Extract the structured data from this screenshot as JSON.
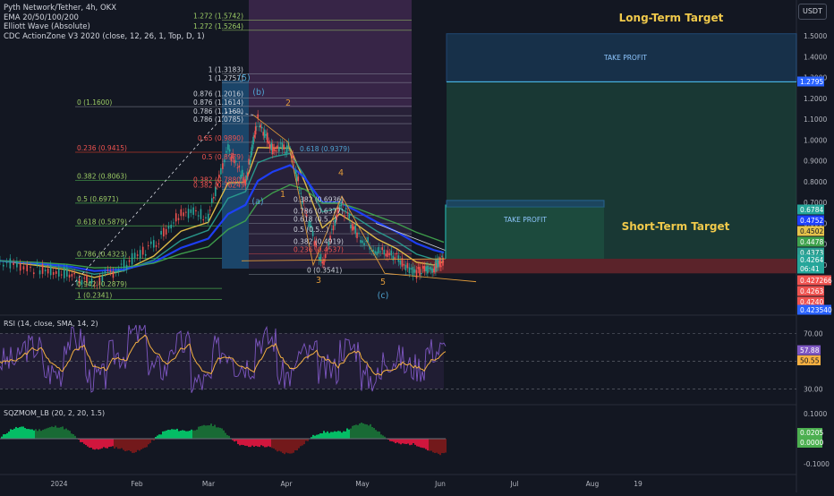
{
  "header": {
    "title": "Pyth Network/Tether, 4h, OKX",
    "indicators": [
      "EMA 20/50/100/200",
      "Elliott Wave (Absolute)",
      "CDC ActionZone V3 2020 (close, 12, 26, 1, Top, D, 1)"
    ],
    "currency_button": "USDT"
  },
  "colors": {
    "background": "#131722",
    "ema20": "#e6c34a",
    "ema50": "#2a9d8f",
    "ema100": "#1e40ff",
    "ema200": "#3fa34d",
    "candle_up": "#26a69a",
    "candle_down": "#ef5350",
    "wave": "#e09a3a",
    "rsi_line": "#7e57c2",
    "rsi_signal": "#f5b041",
    "tp_box": "#1e4f7a",
    "sl_box": "#7a2a2e",
    "target_text": "#f0c94b"
  },
  "chart_data": [
    {
      "type": "line",
      "title": "Pyth Network/Tether, 4h, OKX",
      "x": [
        "2023-12-05",
        "2023-12-20",
        "2024-01-01",
        "2024-01-12",
        "2024-01-24",
        "2024-02-05",
        "2024-02-16",
        "2024-02-27",
        "2024-03-06",
        "2024-03-13",
        "2024-03-18",
        "2024-03-24",
        "2024-03-31",
        "2024-04-06",
        "2024-04-13",
        "2024-04-20",
        "2024-04-27",
        "2024-05-05",
        "2024-05-13",
        "2024-05-21",
        "2024-05-28",
        "2024-06-01"
      ],
      "series": [
        {
          "name": "close",
          "values": [
            0.42,
            0.38,
            0.36,
            0.31,
            0.4,
            0.5,
            0.66,
            0.64,
            0.95,
            0.8,
            1.1,
            0.96,
            0.96,
            0.66,
            0.4,
            0.7,
            0.55,
            0.47,
            0.44,
            0.36,
            0.39,
            0.43
          ]
        }
      ],
      "xticks": [
        "2024",
        "Feb",
        "Mar",
        "Apr",
        "May",
        "Jun",
        "Jul",
        "Aug",
        "19"
      ],
      "yticks": [
        1.5,
        1.4,
        1.3,
        1.2,
        1.1,
        1.0,
        0.9,
        0.8,
        0.7,
        0.6,
        0.5,
        0.4
      ],
      "ylim": [
        0.22,
        1.62
      ],
      "price_labels": [
        "1.2795",
        "0.6784",
        "0.4752",
        "0.4502",
        "0.4478",
        "0.4373",
        "0.4264",
        "06:41",
        "0.427266",
        "0.4263",
        "0.4240",
        "0.423540"
      ],
      "fib_left": [
        {
          "text": "0 (1.1600)",
          "value": 1.16
        },
        {
          "text": "0.236 (0.9415)",
          "value": 0.9415
        },
        {
          "text": "0.382 (0.8063)",
          "value": 0.8063
        },
        {
          "text": "0.5 (0.6971)",
          "value": 0.6971
        },
        {
          "text": "0.618 (0.5879)",
          "value": 0.5879
        },
        {
          "text": "0.786 (0.4323)",
          "value": 0.4323
        },
        {
          "text": "0.942 (0.2879)",
          "value": 0.2879
        },
        {
          "text": "1 (0.2341)",
          "value": 0.2341
        }
      ],
      "fib_mid": [
        {
          "text": "1.272 (1.5742)",
          "value": 1.5742
        },
        {
          "text": "1.272 (1.5264)",
          "value": 1.5264
        },
        {
          "text": "1 (1.3183)",
          "value": 1.3183
        },
        {
          "text": "1 (1.2757)",
          "value": 1.2757
        },
        {
          "text": "0.876 (1.2016)",
          "value": 1.2016
        },
        {
          "text": "0.876 (1.1614)",
          "value": 1.1614
        },
        {
          "text": "0.786 (1.1169)",
          "value": 1.1169
        },
        {
          "text": "0.786 (1.0785)",
          "value": 1.0785
        },
        {
          "text": "0.65 (0.9890)",
          "value": 0.989
        },
        {
          "text": "0.5 (0.8979)",
          "value": 0.8979
        },
        {
          "text": "0.382 (0.7880)",
          "value": 0.788
        },
        {
          "text": "0.382 (0.7624)",
          "value": 0.7624
        }
      ],
      "fib_right": [
        {
          "text": "0.618 (0.9379)",
          "value": 0.9379
        },
        {
          "text": "0.382 (0.6936)",
          "value": 0.6936
        },
        {
          "text": "0.786 (0.6377)",
          "value": 0.6377
        },
        {
          "text": "0.618 (0.5...)",
          "value": 0.6
        },
        {
          "text": "0.5 (0.5...)",
          "value": 0.55
        },
        {
          "text": "0.382 (0.4919)",
          "value": 0.4919
        },
        {
          "text": "0.236 (0.4537)",
          "value": 0.4537
        },
        {
          "text": "0 (0.3541)",
          "value": 0.3541
        }
      ],
      "wave_labels": [
        "(5)",
        "(b)",
        "2",
        "1",
        "4",
        "3",
        "5",
        "(c)",
        "(a)"
      ],
      "annotations": {
        "long_term": "Long-Term Target",
        "short_term": "Short-Term Target",
        "take_profit_1": "TAKE PROFIT",
        "take_profit_2": "TAKE PROFIT"
      },
      "take_profit_long": [
        1.2795,
        1.51
      ],
      "take_profit_short": [
        0.6784,
        0.71
      ],
      "stop_loss_zone": [
        0.36,
        0.43
      ]
    },
    {
      "type": "line",
      "title": "RSI (14, close, SMA, 14, 2)",
      "yticks": [
        70.0,
        50.55,
        30.0
      ],
      "ylim": [
        25,
        78
      ],
      "value_labels": [
        "57.88",
        "50.55"
      ],
      "series": [
        {
          "name": "RSI",
          "values": [
            50,
            60,
            42,
            65,
            38,
            55,
            70,
            45,
            62,
            35,
            58,
            48,
            66,
            40,
            55,
            44,
            60,
            38,
            52,
            46,
            58
          ]
        }
      ]
    },
    {
      "type": "bar",
      "title": "SQZMOM_LB (20, 2, 20, 1.5)",
      "yticks": [
        0.1,
        -0.1
      ],
      "ylim": [
        -0.12,
        0.12
      ],
      "value_labels": [
        "0.0205",
        "0.0000"
      ]
    }
  ]
}
